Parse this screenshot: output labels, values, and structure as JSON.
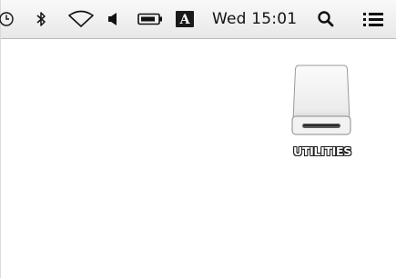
{
  "menubar": {
    "items": [
      {
        "icon": "time-machine-icon"
      },
      {
        "icon": "bluetooth-icon"
      },
      {
        "icon": "wifi-icon"
      },
      {
        "icon": "volume-icon"
      },
      {
        "icon": "battery-icon"
      },
      {
        "icon": "input-source-icon",
        "label": "A"
      },
      {
        "icon": "spotlight-search-icon"
      },
      {
        "icon": "notification-center-icon"
      }
    ],
    "clock": "Wed 15:01"
  },
  "desktop": {
    "items": [
      {
        "label": "UTILITIES",
        "icon": "external-drive-icon"
      }
    ]
  },
  "colors": {
    "desktop_background": "#ffffff",
    "menubar_background": "#f0f0f0",
    "icon_ink": "#111111"
  }
}
